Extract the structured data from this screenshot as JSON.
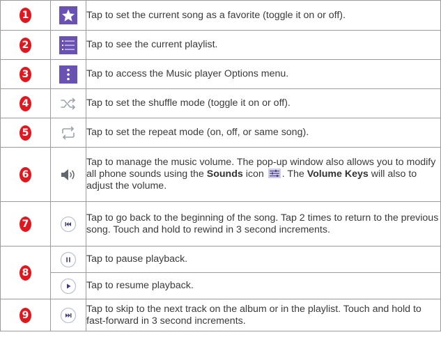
{
  "rows": [
    {
      "num": "1",
      "icon": "star-icon",
      "text": "Tap to set the current song as a favorite (toggle it on or off)."
    },
    {
      "num": "2",
      "icon": "playlist-icon",
      "text": "Tap to see the current playlist."
    },
    {
      "num": "3",
      "icon": "options-menu-icon",
      "text": "Tap to access the Music player Options menu."
    },
    {
      "num": "4",
      "icon": "shuffle-icon",
      "text": "Tap to set the shuffle mode (toggle it on or off)."
    },
    {
      "num": "5",
      "icon": "repeat-icon",
      "text": "Tap to set the repeat mode (on, off, or same song)."
    },
    {
      "num": "6",
      "icon": "volume-icon",
      "text_a": "Tap to manage the music volume. The pop-up window also allows you to modify all phone sounds using the ",
      "bold_a": "Sounds",
      "text_b": " icon ",
      "inline_icon": "sounds-equalizer-icon",
      "text_c": ". The ",
      "bold_b": "Volume Keys",
      "text_d": " will also to adjust the volume."
    },
    {
      "num": "7",
      "icon": "rewind-icon",
      "text": "Tap to go back to the beginning of the song. Tap 2 times to return to the previous song. Touch and hold to rewind in 3 second increments."
    },
    {
      "num": "8",
      "icon_a": "pause-icon",
      "text_a": "Tap to pause playback.",
      "icon_b": "play-icon",
      "text_b": "Tap to resume playback."
    },
    {
      "num": "9",
      "icon": "fast-forward-icon",
      "text": "Tap to skip to the next track on the album or in the playlist. Touch and hold to fast-forward in 3 second increments."
    }
  ],
  "colors": {
    "badge": "#e3161e",
    "icon_tile": "#6a52b3",
    "icon_gray": "#9aa3ad",
    "border": "#9a9a9a"
  }
}
